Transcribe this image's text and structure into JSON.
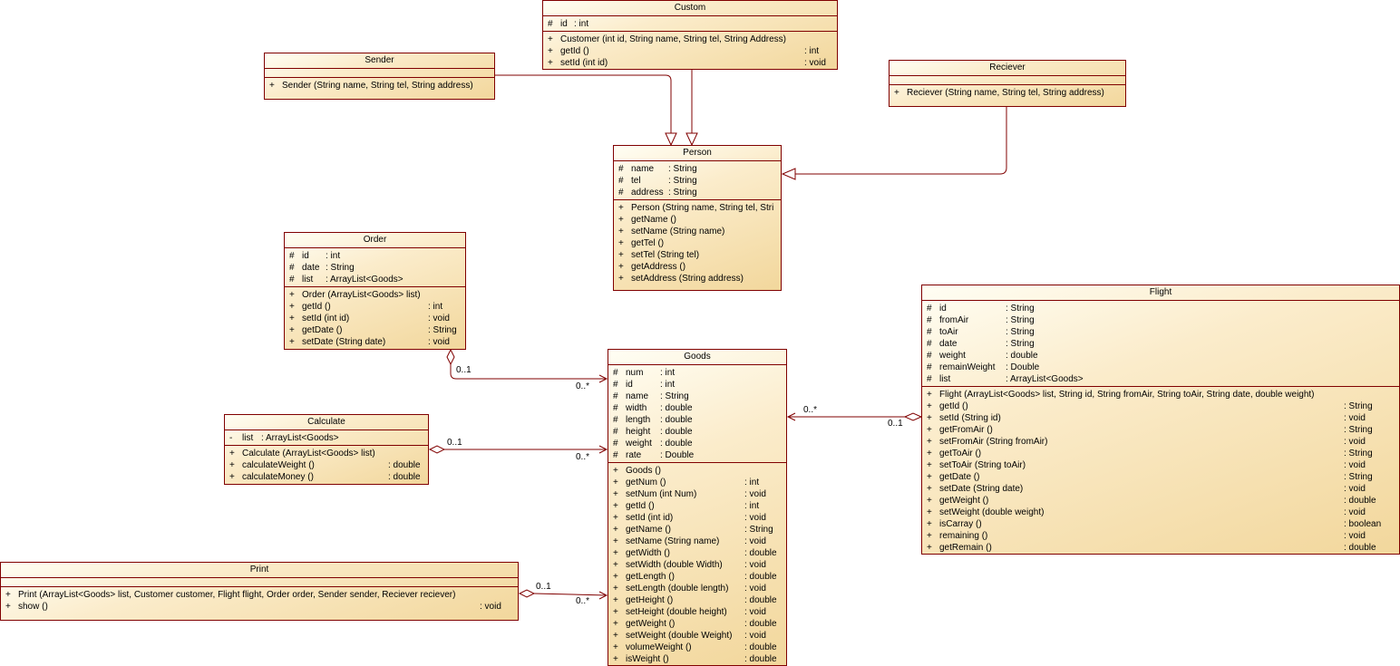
{
  "classes": {
    "custom": {
      "name": "Custom",
      "attributes": [
        {
          "v": "#",
          "n": "id",
          "t": ": int"
        }
      ],
      "operations": [
        {
          "v": "+",
          "n": "Customer (int id, String name, String tel, String Address)",
          "t": ""
        },
        {
          "v": "+",
          "n": "getId ()",
          "t": ": int"
        },
        {
          "v": "+",
          "n": "setId (int id)",
          "t": ": void"
        }
      ]
    },
    "sender": {
      "name": "Sender",
      "attributes": [],
      "operations": [
        {
          "v": "+",
          "n": "Sender (String name, String tel, String address)",
          "t": ""
        }
      ]
    },
    "reciever": {
      "name": "Reciever",
      "attributes": [],
      "operations": [
        {
          "v": "+",
          "n": "Reciever (String name, String tel, String address)",
          "t": ""
        }
      ]
    },
    "person": {
      "name": "Person",
      "attributes": [
        {
          "v": "#",
          "n": "name",
          "t": ": String"
        },
        {
          "v": "#",
          "n": "tel",
          "t": ": String"
        },
        {
          "v": "#",
          "n": "address",
          "t": ": String"
        }
      ],
      "operations": [
        {
          "v": "+",
          "n": "Person (String name, String tel, Stri",
          "t": ""
        },
        {
          "v": "+",
          "n": "getName ()",
          "t": ""
        },
        {
          "v": "+",
          "n": "setName (String name)",
          "t": ""
        },
        {
          "v": "+",
          "n": "getTel ()",
          "t": ""
        },
        {
          "v": "+",
          "n": "setTel (String tel)",
          "t": ""
        },
        {
          "v": "+",
          "n": "getAddress ()",
          "t": ""
        },
        {
          "v": "+",
          "n": "setAddress (String address)",
          "t": ""
        }
      ]
    },
    "order": {
      "name": "Order",
      "attributes": [
        {
          "v": "#",
          "n": "id",
          "t": ": int"
        },
        {
          "v": "#",
          "n": "date",
          "t": ": String"
        },
        {
          "v": "#",
          "n": "list",
          "t": ": ArrayList<Goods>"
        }
      ],
      "operations": [
        {
          "v": "+",
          "n": "Order (ArrayList<Goods> list)",
          "t": ""
        },
        {
          "v": "+",
          "n": "getId ()",
          "t": ": int"
        },
        {
          "v": "+",
          "n": "setId (int id)",
          "t": ": void"
        },
        {
          "v": "+",
          "n": "getDate ()",
          "t": ": String"
        },
        {
          "v": "+",
          "n": "setDate (String date)",
          "t": ": void"
        }
      ]
    },
    "calculate": {
      "name": "Calculate",
      "attributes": [
        {
          "v": "-",
          "n": "list",
          "t": ": ArrayList<Goods>"
        }
      ],
      "operations": [
        {
          "v": "+",
          "n": "Calculate (ArrayList<Goods> list)",
          "t": ""
        },
        {
          "v": "+",
          "n": "calculateWeight ()",
          "t": ": double"
        },
        {
          "v": "+",
          "n": "calculateMoney ()",
          "t": ": double"
        }
      ]
    },
    "print": {
      "name": "Print",
      "attributes": [],
      "operations": [
        {
          "v": "+",
          "n": "Print (ArrayList<Goods> list, Customer customer, Flight flight, Order order, Sender sender, Reciever reciever)",
          "t": ""
        },
        {
          "v": "+",
          "n": "show ()",
          "t": ": void"
        }
      ]
    },
    "goods": {
      "name": "Goods",
      "attributes": [
        {
          "v": "#",
          "n": "num",
          "t": ": int"
        },
        {
          "v": "#",
          "n": "id",
          "t": ": int"
        },
        {
          "v": "#",
          "n": "name",
          "t": ": String"
        },
        {
          "v": "#",
          "n": "width",
          "t": ": double"
        },
        {
          "v": "#",
          "n": "length",
          "t": ": double"
        },
        {
          "v": "#",
          "n": "height",
          "t": ": double"
        },
        {
          "v": "#",
          "n": "weight",
          "t": ": double"
        },
        {
          "v": "#",
          "n": "rate",
          "t": ": Double"
        }
      ],
      "operations": [
        {
          "v": "+",
          "n": "Goods ()",
          "t": ""
        },
        {
          "v": "+",
          "n": "getNum ()",
          "t": ": int"
        },
        {
          "v": "+",
          "n": "setNum (int Num)",
          "t": ": void"
        },
        {
          "v": "+",
          "n": "getId ()",
          "t": ": int"
        },
        {
          "v": "+",
          "n": "setId (int id)",
          "t": ": void"
        },
        {
          "v": "+",
          "n": "getName ()",
          "t": ": String"
        },
        {
          "v": "+",
          "n": "setName (String name)",
          "t": ": void"
        },
        {
          "v": "+",
          "n": "getWidth ()",
          "t": ": double"
        },
        {
          "v": "+",
          "n": "setWidth (double Width)",
          "t": ": void"
        },
        {
          "v": "+",
          "n": "getLength ()",
          "t": ": double"
        },
        {
          "v": "+",
          "n": "setLength (double length)",
          "t": ": void"
        },
        {
          "v": "+",
          "n": "getHeight ()",
          "t": ": double"
        },
        {
          "v": "+",
          "n": "setHeight (double height)",
          "t": ": void"
        },
        {
          "v": "+",
          "n": "getWeight ()",
          "t": ": double"
        },
        {
          "v": "+",
          "n": "setWeight (double Weight)",
          "t": ": void"
        },
        {
          "v": "+",
          "n": "volumeWeight ()",
          "t": ": double"
        },
        {
          "v": "+",
          "n": "isWeight ()",
          "t": ": double"
        }
      ]
    },
    "flight": {
      "name": "Flight",
      "attributes": [
        {
          "v": "#",
          "n": "id",
          "t": ": String"
        },
        {
          "v": "#",
          "n": "fromAir",
          "t": ": String"
        },
        {
          "v": "#",
          "n": "toAir",
          "t": ": String"
        },
        {
          "v": "#",
          "n": "date",
          "t": ": String"
        },
        {
          "v": "#",
          "n": "weight",
          "t": ": double"
        },
        {
          "v": "#",
          "n": "remainWeight",
          "t": ": Double"
        },
        {
          "v": "#",
          "n": "list",
          "t": ": ArrayList<Goods>"
        }
      ],
      "operations": [
        {
          "v": "+",
          "n": "Flight (ArrayList<Goods> list, String id, String fromAir, String toAir, String date, double weight)",
          "t": ""
        },
        {
          "v": "+",
          "n": "getId ()",
          "t": ": String"
        },
        {
          "v": "+",
          "n": "setId (String id)",
          "t": ": void"
        },
        {
          "v": "+",
          "n": "getFromAir ()",
          "t": ": String"
        },
        {
          "v": "+",
          "n": "setFromAir (String fromAir)",
          "t": ": void"
        },
        {
          "v": "+",
          "n": "getToAir ()",
          "t": ": String"
        },
        {
          "v": "+",
          "n": "setToAir (String toAir)",
          "t": ": void"
        },
        {
          "v": "+",
          "n": "getDate ()",
          "t": ": String"
        },
        {
          "v": "+",
          "n": "setDate (String date)",
          "t": ": void"
        },
        {
          "v": "+",
          "n": "getWeight ()",
          "t": ": double"
        },
        {
          "v": "+",
          "n": "setWeight (double weight)",
          "t": ": void"
        },
        {
          "v": "+",
          "n": "isCarray ()",
          "t": ": boolean"
        },
        {
          "v": "+",
          "n": "remaining ()",
          "t": ": void"
        },
        {
          "v": "+",
          "n": "getRemain ()",
          "t": ": double"
        }
      ]
    }
  },
  "multiplicities": {
    "order_src": "0..1",
    "order_dst": "0..*",
    "calc_src": "0..1",
    "calc_dst": "0..*",
    "print_src": "0..1",
    "print_dst": "0..*",
    "flight_src": "0..1",
    "flight_dst": "0..*"
  },
  "colors": {
    "line": "#800000",
    "fill_light": "#fffef4",
    "fill_dark": "#f2d79c"
  }
}
